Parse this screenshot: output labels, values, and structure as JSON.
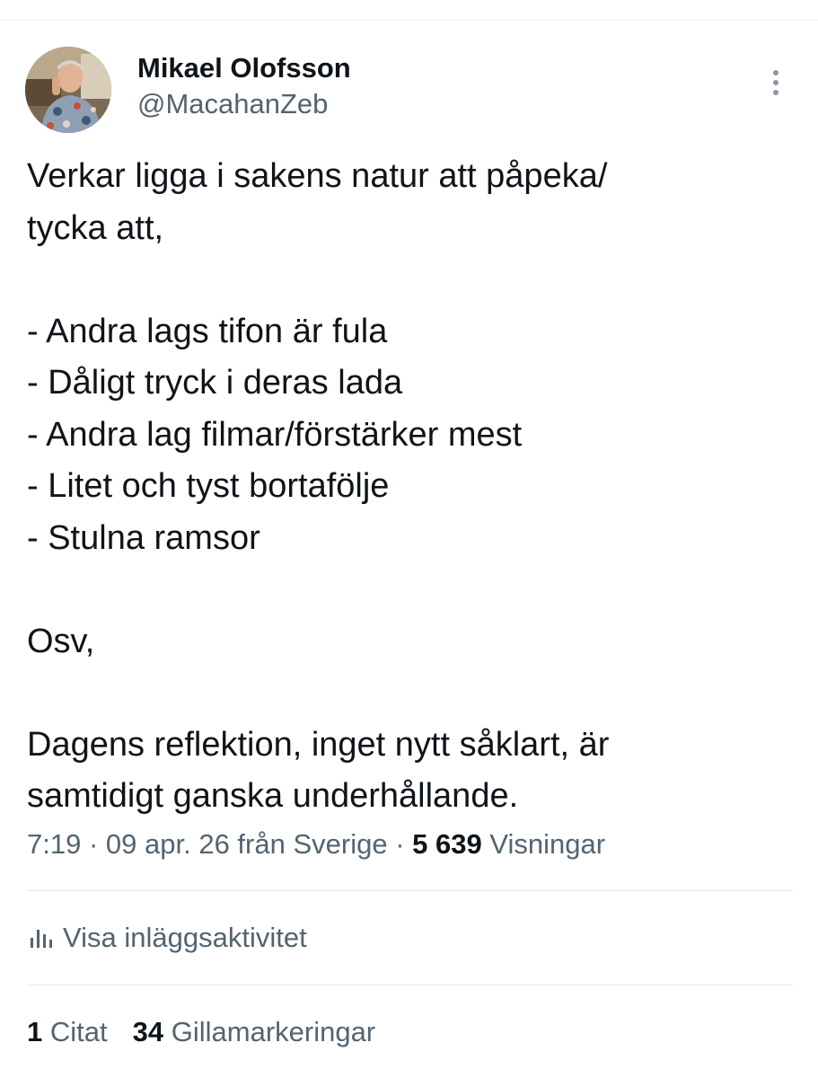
{
  "author": {
    "display_name": "Mikael Olofsson",
    "handle": "@MacahanZeb"
  },
  "tweet": {
    "lines": [
      "Verkar ligga i sakens natur att påpeka/",
      "tycka att,",
      "",
      "- Andra lags tifon är fula",
      "- Dåligt tryck i deras lada",
      "- Andra lag filmar/förstärker mest",
      "- Litet och tyst bortafölje",
      "- Stulna ramsor",
      "",
      "Osv,",
      "",
      "Dagens reflektion, inget nytt såklart, är",
      "samtidigt ganska underhållande."
    ]
  },
  "meta": {
    "time": "7:19",
    "separator": "·",
    "date_source": "09 apr. 26 från Sverige",
    "views_count": "5 639",
    "views_label": "Visningar"
  },
  "activity": {
    "label": "Visa inläggsaktivitet",
    "icon": "bar-chart-icon"
  },
  "stats": {
    "quotes_count": "1",
    "quotes_label": "Citat",
    "likes_count": "34",
    "likes_label": "Gillamarkeringar"
  },
  "colors": {
    "text_primary": "#0f1419",
    "text_secondary": "#536471",
    "divider": "#e4e8ea"
  }
}
